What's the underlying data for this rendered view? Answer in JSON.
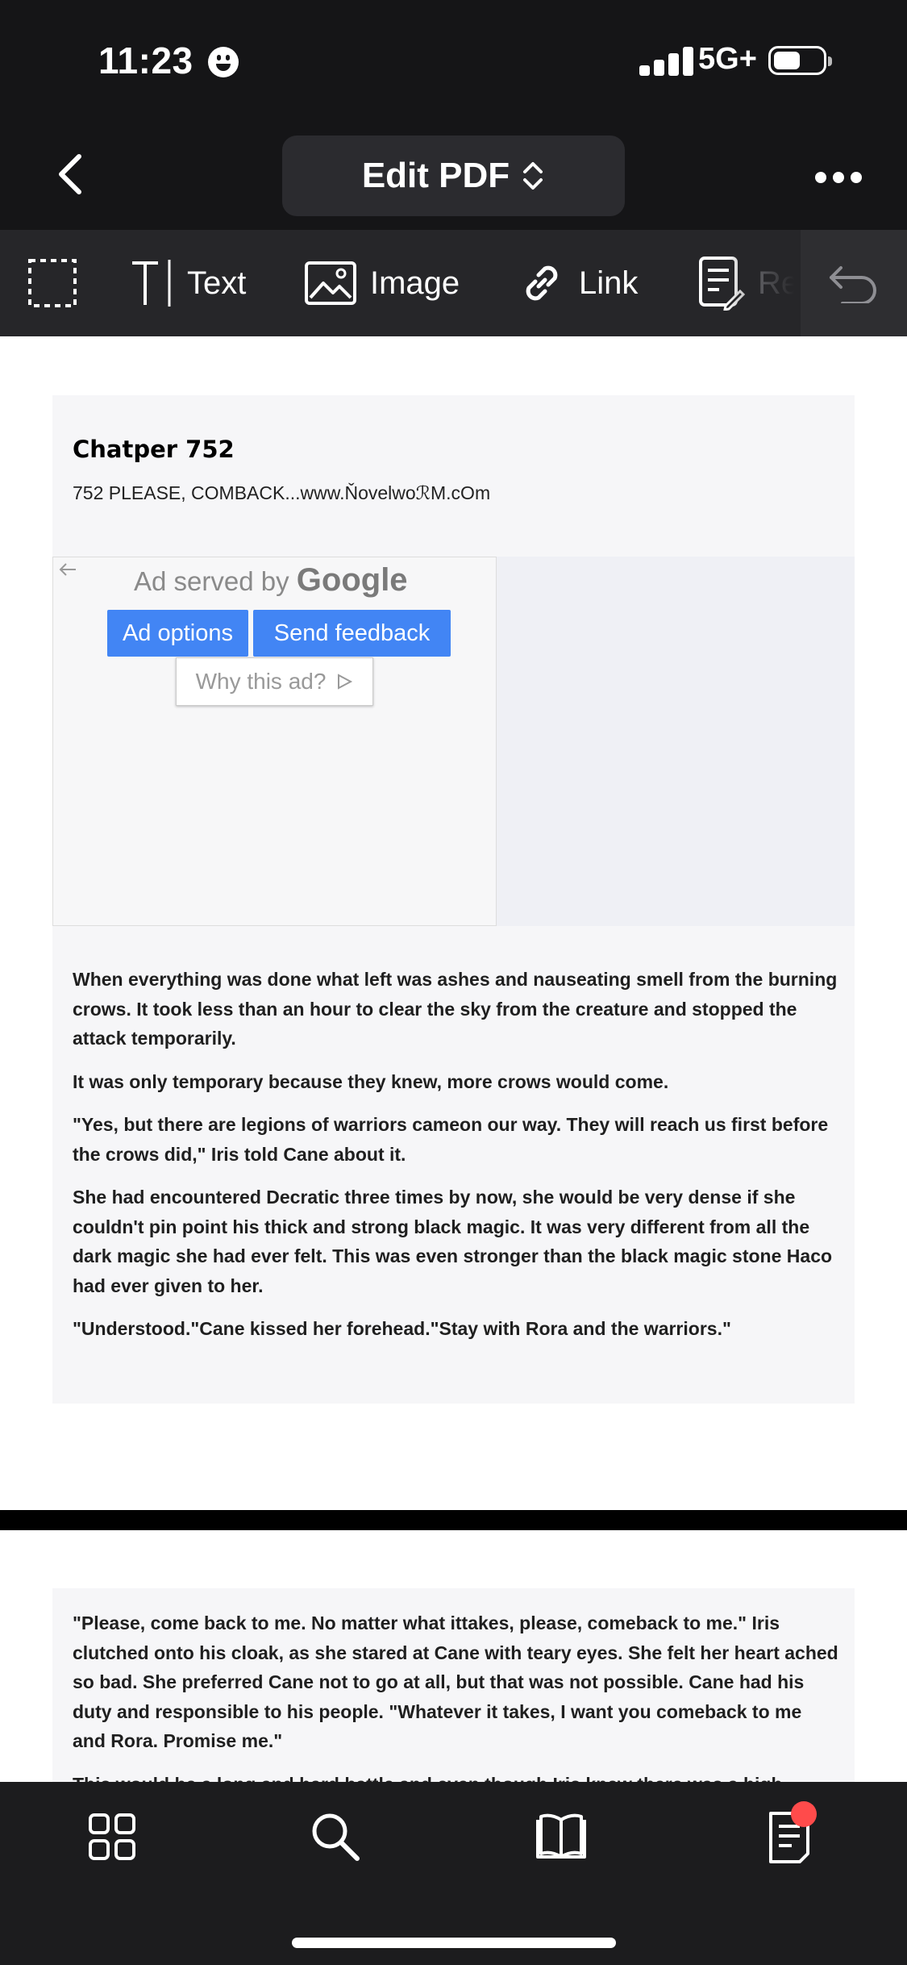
{
  "status_bar": {
    "time": "11:23",
    "network": "5G+",
    "emoji_icon": "smiley-face-icon",
    "battery_level": 0.55
  },
  "nav": {
    "title": "Edit PDF",
    "back_icon": "chevron-left-icon",
    "title_chevron_icon": "chevron-up-down-icon",
    "more_icon": "ellipsis-icon"
  },
  "toolbar": {
    "items": [
      {
        "label": "",
        "icon": "dashed-selection-icon"
      },
      {
        "label": "Text",
        "icon": "text-cursor-icon"
      },
      {
        "label": "Image",
        "icon": "image-icon"
      },
      {
        "label": "Link",
        "icon": "link-icon"
      },
      {
        "label": "Re",
        "icon": "edit-document-icon"
      }
    ],
    "undo_icon": "undo-icon"
  },
  "document": {
    "page1": {
      "chapter_title": "Chatper 752",
      "chapter_subtitle": "752 PLEASE, COMBACK...www.ŇovelwoℛM.cOm",
      "ad": {
        "served_by": "Ad served by ",
        "brand": "Google",
        "options_button": "Ad options",
        "feedback_button": "Send feedback",
        "why_button": "Why this ad?"
      },
      "paragraphs": [
        "When everything was done what left was ashes and nauseating smell from the burning crows. It took less than an hour to clear the sky from the creature and stopped the attack temporarily.",
        "It was only temporary because they knew, more crows would come.",
        "\"Yes, but there are legions of warriors cameon our way. They will reach us first before the crows did,\" Iris told Cane about it.",
        "She had encountered Decratic three times by now, she would be very dense if she couldn't pin point his thick and strong black magic. It was very different from all the dark magic she had ever felt. This was even stronger than the black magic stone Haco had ever given to her.",
        "\"Understood.\"Cane kissed her forehead.\"Stay with Rora and the warriors.\""
      ]
    },
    "page2": {
      "paragraphs": [
        "\"Please, come back to me. No matter what ittakes, please, comeback to me.\" Iris clutched onto his cloak, as she stared at Cane with teary eyes. She felt her heart ached so bad. She preferred Cane not to go at all, but that was not possible. Cane had his duty and responsible to his people. \"Whatever it takes, I want you comeback to me and Rora. Promise me.\"",
        "This would be a long and hard battle and even though Iris knew there was a high"
      ]
    }
  },
  "bottom_bar": {
    "items": [
      "grid-icon",
      "search-icon",
      "book-icon",
      "document-list-icon"
    ],
    "badge_color": "#ff4b4b"
  }
}
